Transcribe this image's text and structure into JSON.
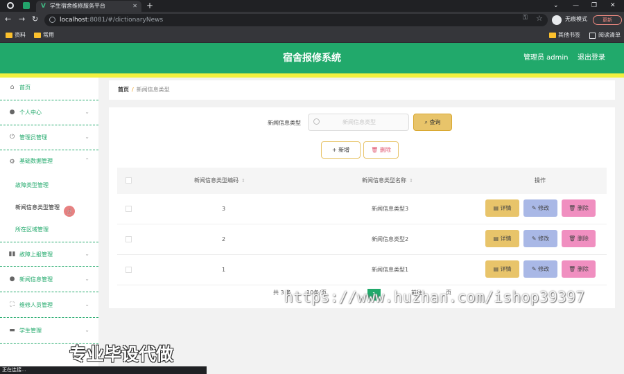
{
  "browser": {
    "tab_title": "学生宿舍维修服务平台",
    "url_host": "localhost",
    "url_path": ":8081/#/dictionaryNews",
    "incognito_label": "无痕模式",
    "update_label": "更新",
    "bookmarks": [
      "资料",
      "常用"
    ],
    "bookmarks_right": [
      "其他书签",
      "阅读清单"
    ],
    "status_text": "正在连接..."
  },
  "header": {
    "title": "宿舍报修系统",
    "user": "管理员 admin",
    "logout": "退出登录"
  },
  "sidebar": {
    "items": [
      {
        "label": "首页",
        "icon": "home-icon"
      },
      {
        "label": "个人中心",
        "icon": "user-icon"
      },
      {
        "label": "管理员管理",
        "icon": "power-icon"
      },
      {
        "label": "基础数据管理",
        "icon": "settings-icon"
      },
      {
        "label": "故障上报管理",
        "icon": "chart-icon"
      },
      {
        "label": "新闻信息管理",
        "icon": "user-icon"
      },
      {
        "label": "维修人员管理",
        "icon": "frame-icon"
      },
      {
        "label": "学生管理",
        "icon": "bag-icon"
      }
    ],
    "sub_items": [
      "故障类型管理",
      "新闻信息类型管理",
      "所在区域管理"
    ]
  },
  "breadcrumb": {
    "home": "首页",
    "separator": "/",
    "current": "新闻信息类型"
  },
  "search": {
    "label": "新闻信息类型",
    "placeholder": "新闻信息类型",
    "query_button": "查询"
  },
  "actions": {
    "add": "新增",
    "delete": "删除"
  },
  "table": {
    "columns": [
      "新闻信息类型编码",
      "新闻信息类型名称",
      "操作"
    ],
    "rows": [
      {
        "code": "3",
        "name": "新闻信息类型3"
      },
      {
        "code": "2",
        "name": "新闻信息类型2"
      },
      {
        "code": "1",
        "name": "新闻信息类型1"
      }
    ],
    "row_actions": {
      "detail": "详情",
      "edit": "修改",
      "remove": "删除"
    }
  },
  "pagination": {
    "total_text": "共 3 条",
    "page_size_text": "10条/页",
    "current_page": "1",
    "goto_text": "前往",
    "page_suffix": "页"
  },
  "overlay": {
    "watermark": "https://www.huzhan.com/ishop39397",
    "promo": "专业毕设代做"
  },
  "colors": {
    "primary_green": "#21a96b",
    "accent_yellow": "#f2f03f",
    "detail_button": "#e8c46a",
    "edit_button": "#a9b8e6",
    "delete_button": "#f08fc0"
  }
}
